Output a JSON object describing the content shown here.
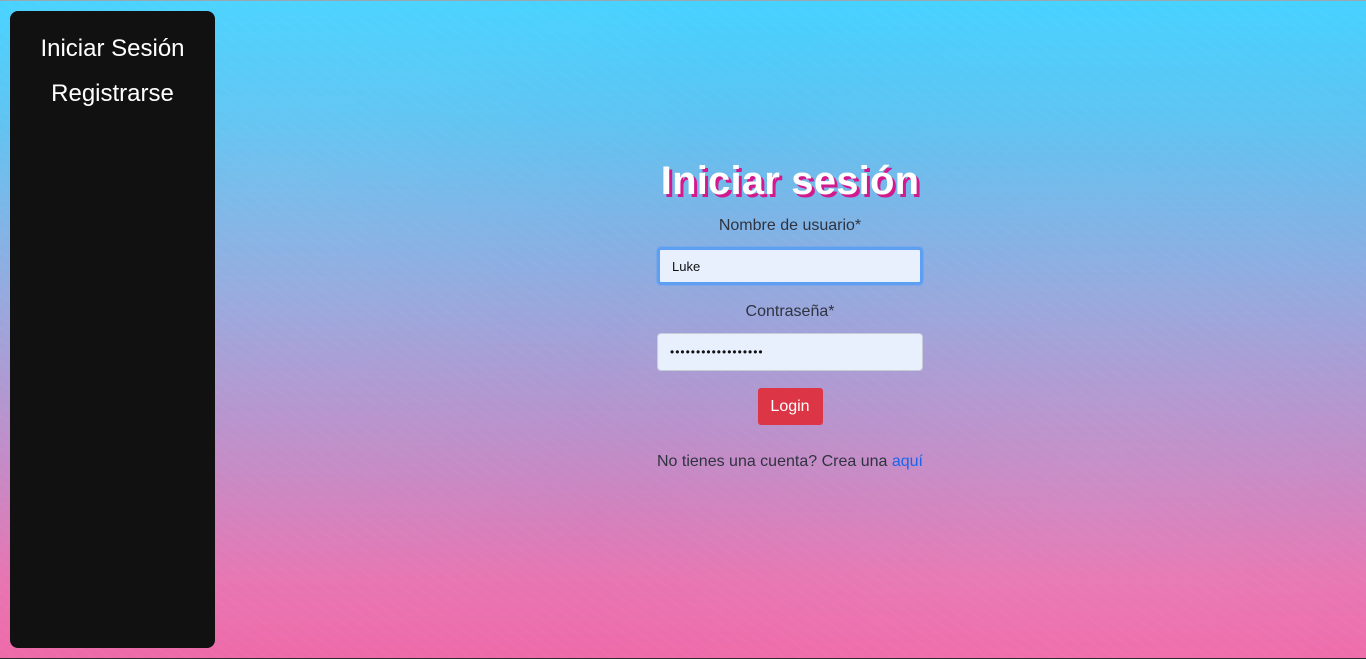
{
  "sidebar": {
    "items": [
      {
        "label": "Iniciar Sesión"
      },
      {
        "label": "Registrarse"
      }
    ]
  },
  "form": {
    "title": "Iniciar sesión",
    "username_label": "Nombre de usuario*",
    "username_value": "Luke",
    "password_label": "Contraseña*",
    "password_value": "••••••••••••••••••",
    "submit_label": "Login",
    "signup_text": "No tienes una cuenta? Crea una",
    "signup_link": "aquí"
  },
  "colors": {
    "sidebar_bg": "#111111",
    "title_shadow": "#d21a8e",
    "button_bg": "#dc3545",
    "link": "#1a64e8",
    "input_bg": "#e8f0fe",
    "focus_border": "#5d9ff2"
  }
}
